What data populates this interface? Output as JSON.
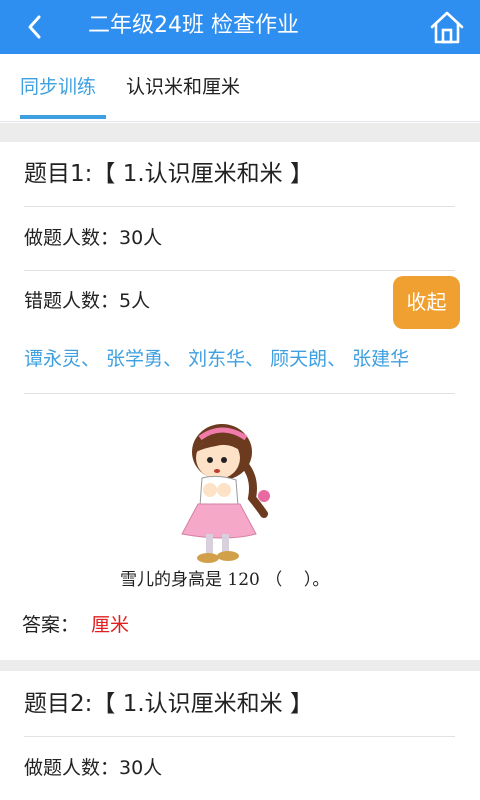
{
  "header": {
    "title": "二年级24班 检查作业",
    "back_icon": "back-chevron-icon",
    "home_icon": "home-icon"
  },
  "tabs": [
    {
      "label": "同步训练",
      "active": true
    },
    {
      "label": "认识米和厘米",
      "active": false
    }
  ],
  "questions": [
    {
      "title": "题目1:【 1.认识厘米和米 】",
      "answered": "做题人数：30人",
      "wrong": "错题人数：5人",
      "collapse_label": "收起",
      "wrong_names": "谭永灵、 张学勇、 刘东华、 顾天朗、 张建华",
      "question_text": "雪儿的身高是 120 （    ）。",
      "answer_label": "答案：",
      "answer_value": "厘米"
    },
    {
      "title": "题目2:【 1.认识厘米和米 】",
      "answered": "做题人数：30人"
    }
  ],
  "colors": {
    "header_bg": "#2f8ff0",
    "accent": "#3ea0e0",
    "button": "#f0a030",
    "answer": "#e02020"
  }
}
